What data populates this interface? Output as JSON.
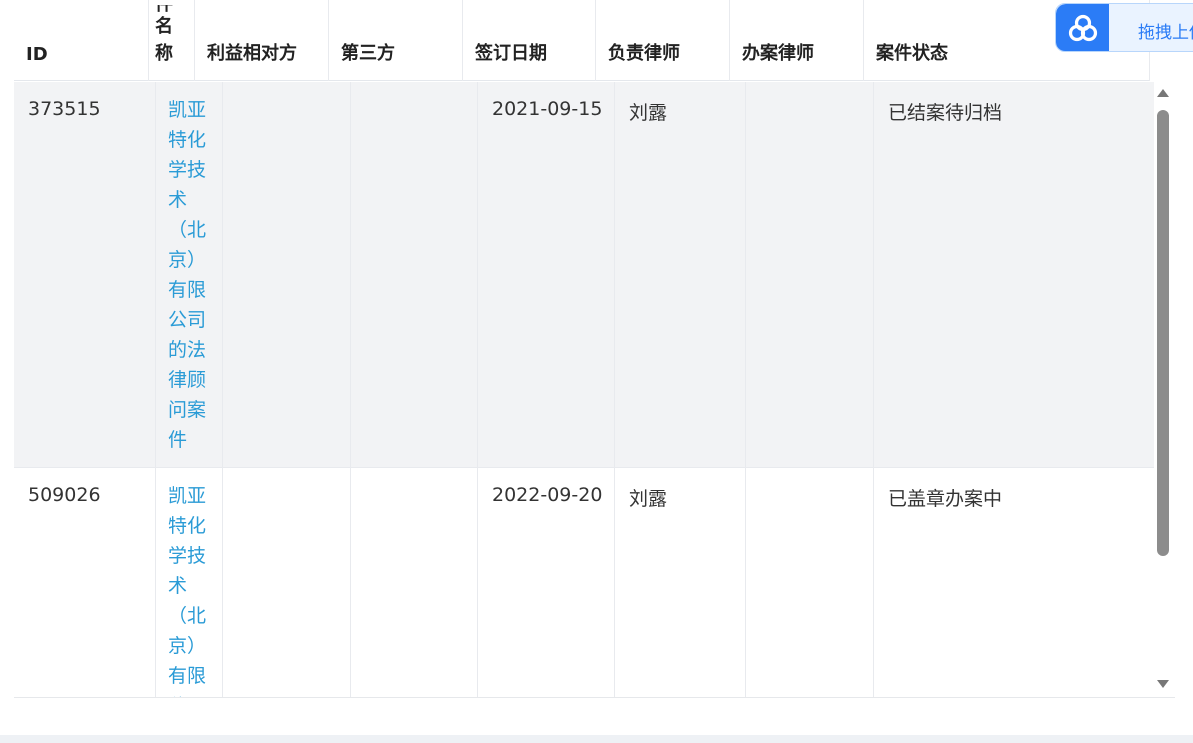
{
  "table": {
    "headers": {
      "id": "ID",
      "case_name": "名称",
      "case_name_top": "件",
      "counterparty": "利益相对方",
      "third_party": "第三方",
      "sign_date": "签订日期",
      "lead_lawyer": "负责律师",
      "handling_lawyer": "办案律师",
      "case_status": "案件状态"
    },
    "rows": [
      {
        "id": "373515",
        "case_name": "凯亚特化学技术（北京）有限公司的法律顾问案件",
        "counterparty": "",
        "third_party": "",
        "sign_date": "2021-09-15",
        "lead_lawyer": "刘露",
        "handling_lawyer": "",
        "case_status": "已结案待归档"
      },
      {
        "id": "509026",
        "case_name": "凯亚特化学技术（北京）有限公司",
        "counterparty": "",
        "third_party": "",
        "sign_date": "2022-09-20",
        "lead_lawyer": "刘露",
        "handling_lawyer": "",
        "case_status": "已盖章办案中"
      }
    ]
  },
  "upload_widget": {
    "label": "拖拽上传",
    "icon": "cloud-icon",
    "accent_color": "#2b7cf6"
  },
  "colors": {
    "link": "#2a9bd6",
    "row_alt_bg": "#f2f3f5"
  }
}
